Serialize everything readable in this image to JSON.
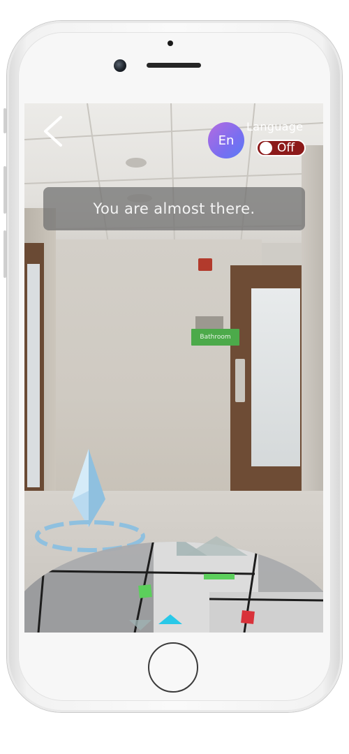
{
  "screen": {
    "back_icon": "chevron-left-icon",
    "language": {
      "avatar_text": "En",
      "label": "Language",
      "toggle_text": "Off",
      "toggle_color": "#8c1a1a"
    },
    "banner_text": "You are almost there.",
    "ar_label": "Bathroom",
    "colors": {
      "avatar_gradient": [
        "#b46be0",
        "#5a7cf5"
      ],
      "tag_green": "#4caa4a",
      "marker_green": "#5ccf5c",
      "marker_red": "#d9323a",
      "arrow_cyan": "#29c8e8"
    },
    "minimap_icons": [
      "cyan-arrow-icon",
      "green-marker-icon",
      "red-marker-icon"
    ]
  }
}
